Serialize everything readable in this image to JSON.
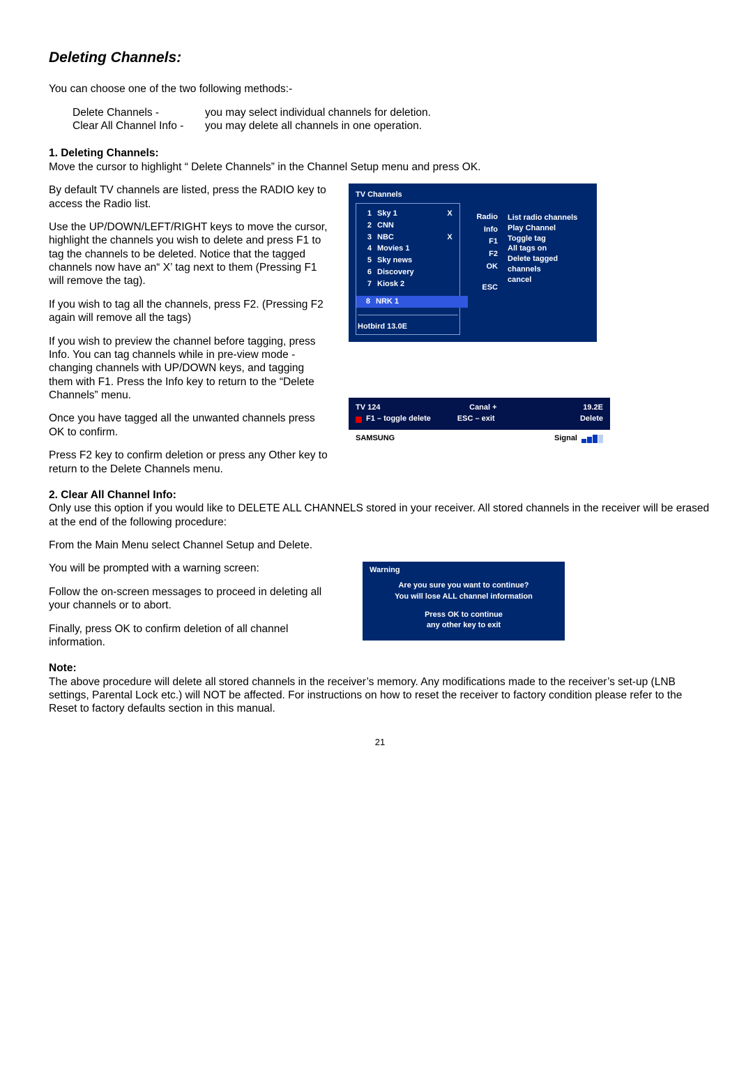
{
  "page_number": "21",
  "heading": "Deleting Channels:",
  "intro": "You can choose one of the two following methods:-",
  "methods": {
    "row1": {
      "label": "Delete Channels -",
      "desc": "you may select individual channels for deletion."
    },
    "row2": {
      "label": "Clear All Channel Info -",
      "desc": "you may delete all channels in one operation."
    }
  },
  "sec1": {
    "title": "1. Deleting Channels:",
    "p1": "Move the cursor to highlight “ Delete Channels” in the Channel Setup menu and press OK.",
    "p2": "By default TV channels are listed, press the RADIO key to access the Radio list.",
    "p3": "Use the UP/DOWN/LEFT/RIGHT keys to move the cursor, highlight the channels you wish to delete and press F1 to tag the channels to be deleted.  Notice that the tagged channels now have an“ X’ tag next to them (Pressing F1 will remove the tag).",
    "p4": "If you wish to tag all the channels, press F2. (Pressing F2 again will remove all the tags)",
    "p5": "If you wish to preview the channel before tagging, press Info.  You can tag channels while in pre-view mode - changing channels with UP/DOWN keys, and tagging them with F1.  Press the Info key to return to the “Delete Channels” menu.",
    "p6": "Once you have tagged all the unwanted channels press OK to confirm.",
    "p7": "Press F2 key to confirm deletion or press any Other key to return to the Delete Channels menu."
  },
  "panel": {
    "title": "TV Channels",
    "channels": [
      {
        "num": "1",
        "name": "Sky 1",
        "tag": "X"
      },
      {
        "num": "2",
        "name": "CNN",
        "tag": ""
      },
      {
        "num": "3",
        "name": "NBC",
        "tag": "X"
      },
      {
        "num": "4",
        "name": "Movies 1",
        "tag": ""
      },
      {
        "num": "5",
        "name": "Sky news",
        "tag": ""
      },
      {
        "num": "6",
        "name": "Discovery",
        "tag": ""
      },
      {
        "num": "7",
        "name": "Kiosk 2",
        "tag": ""
      },
      {
        "num": "8",
        "name": "NRK 1",
        "tag": "",
        "selected": true
      }
    ],
    "satellite": "Hotbird   13.0E",
    "keys": {
      "radio": "Radio",
      "info": "Info",
      "f1": "F1",
      "f2": "F2",
      "ok": "OK",
      "esc": "ESC"
    },
    "desc": {
      "radio": "List radio channels",
      "info": "Play Channel",
      "f1": "Toggle tag",
      "f2": "All tags on",
      "ok": "Delete tagged channels",
      "esc": "cancel"
    }
  },
  "osd": {
    "id": "TV 124",
    "channel": "Canal +",
    "pos": "19.2E",
    "f1": "F1 – toggle delete",
    "esc": "ESC –  exit",
    "delete": "Delete",
    "brand": "SAMSUNG",
    "signal_label": "Signal"
  },
  "sec2": {
    "title": "2. Clear All Channel Info:",
    "p1": "Only use this option if you would like to DELETE ALL CHANNELS stored in your receiver.  All stored channels in the receiver will be erased at the end of the following procedure:",
    "p2": "From the Main Menu select Channel Setup and Delete.",
    "p3": "You will be prompted with a warning screen:",
    "p4": "Follow the on-screen messages to proceed in deleting all your channels or to abort.",
    "p5": "Finally, press OK to confirm deletion of all channel information."
  },
  "warn": {
    "title": "Warning",
    "l1": "Are you sure you want to continue?",
    "l2": "You will lose ALL channel information",
    "l3": "Press OK to continue",
    "l4": "any other key to exit"
  },
  "note": {
    "title": "Note:",
    "body": "The above procedure will delete all stored channels in the receiver’s memory. Any modifications made to the receiver’s set-up (LNB settings, Parental Lock etc.) will NOT be affected. For instructions on how to reset the receiver to factory condition please refer to the Reset to factory defaults section in this manual."
  }
}
